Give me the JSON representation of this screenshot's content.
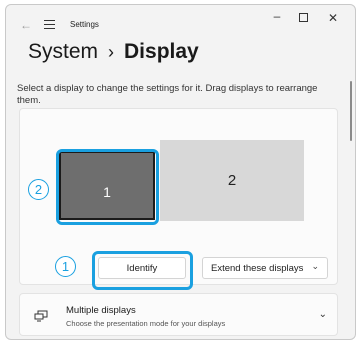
{
  "window": {
    "title": "Settings",
    "minimize": "–",
    "close": "✕"
  },
  "header": {
    "section": "System",
    "separator": "›",
    "current": "Display"
  },
  "description": "Select a display to change the settings for it. Drag displays to rearrange them.",
  "monitors": [
    {
      "number": "1",
      "selected": true
    },
    {
      "number": "2",
      "selected": false
    }
  ],
  "callouts": {
    "monitor": "2",
    "identify": "1"
  },
  "buttons": {
    "identify": "Identify",
    "extend": "Extend these displays",
    "extend_chevron": "⌄"
  },
  "multiple_displays": {
    "title": "Multiple displays",
    "subtitle": "Choose the presentation mode for your displays",
    "chevron": "⌄"
  },
  "icons": {
    "back": "←",
    "menu": "hamburger-icon",
    "display": "multiple-displays-icon"
  },
  "colors": {
    "highlight": "#1aa0e0",
    "selected_monitor": "#6e6e6e",
    "other_monitor": "#d8d8d8"
  }
}
